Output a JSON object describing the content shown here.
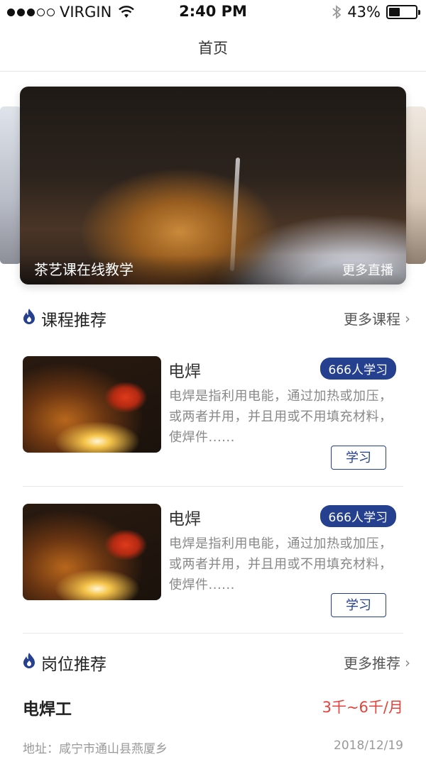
{
  "status": {
    "carrier": "VIRGIN",
    "time": "2:40 PM",
    "battery": "43%",
    "battery_level": 0.43
  },
  "nav": {
    "title": "首页"
  },
  "banner": {
    "caption": "茶艺课在线教学",
    "more": "更多直播"
  },
  "courses_section": {
    "title": "课程推荐",
    "more": "更多课程"
  },
  "courses": [
    {
      "name": "电焊",
      "badge": "666人学习",
      "desc": "电焊是指利用电能，通过加热或加压，或两者并用，并且用或不用填充材料，使焊件......",
      "button": "学习"
    },
    {
      "name": "电焊",
      "badge": "666人学习",
      "desc": "电焊是指利用电能，通过加热或加压，或两者并用，并且用或不用填充材料，使焊件......",
      "button": "学习"
    }
  ],
  "jobs_section": {
    "title": "岗位推荐",
    "more": "更多推荐"
  },
  "job": {
    "title": "电焊工",
    "salary": "3千~6千/月",
    "address": "地址：咸宁市通山县燕厦乡",
    "date": "2018/12/19"
  },
  "colors": {
    "accent": "#24408e",
    "salary": "#e2433b"
  }
}
